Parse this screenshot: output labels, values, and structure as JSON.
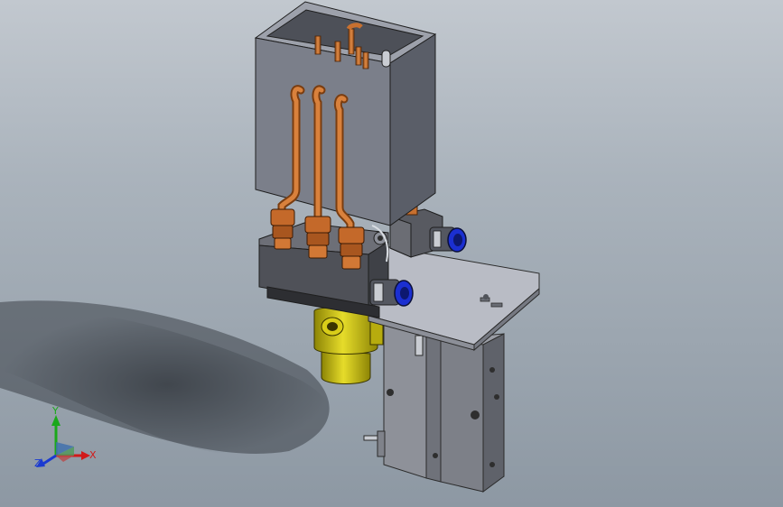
{
  "viewport": {
    "background_top": "#c2c8cf",
    "background_bottom": "#8d98a3"
  },
  "model": {
    "parts": [
      "hopper-box",
      "copper-pipe",
      "manifold-block",
      "nut-fitting",
      "solenoid-valve",
      "push-in-fitting",
      "mounting-plate",
      "pneumatic-slide-cylinder",
      "yellow-coupling"
    ],
    "colors": {
      "hopper": "#767b87",
      "copper": "#c8702f",
      "manifold": "#5d5f66",
      "plate": "#b7bac3",
      "slide": "#8a8d95",
      "coupling": "#d1c614",
      "fitting_cap": "#1b2fd1"
    }
  },
  "triad": {
    "axis_x": "X",
    "axis_y": "Y",
    "axis_z": "Z",
    "colors": {
      "x": "#d11a1a",
      "y": "#1aa81a",
      "z": "#1a3ad1"
    }
  }
}
